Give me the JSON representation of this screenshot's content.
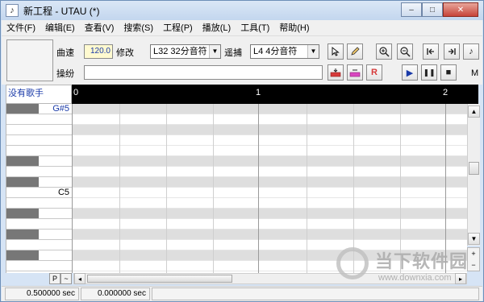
{
  "window": {
    "title": "新工程 - UTAU (*)",
    "app_icon": "music-note-icon",
    "buttons": {
      "minimize": "–",
      "maximize": "□",
      "close": "✕"
    }
  },
  "menu": [
    "文件(F)",
    "编辑(E)",
    "查看(V)",
    "搜索(S)",
    "工程(P)",
    "播放(L)",
    "工具(T)",
    "帮助(H)"
  ],
  "toolbar": {
    "tempo_label": "曲速",
    "tempo_value": "120.0",
    "tempo_after": "修改",
    "note_length": "L32 32分音符",
    "snap_label": "遥捕",
    "snap_value": "L4  4分音符",
    "lyric_label": "操纷",
    "lyric_value": "",
    "icons": {
      "pointer": "pointer-icon",
      "pencil": "pencil-icon",
      "zoom_in": "zoom-in-icon",
      "zoom_out": "zoom-out-icon",
      "go_start": "go-start-icon",
      "go_end": "go-end-icon",
      "note": "note-icon",
      "insert_note": "insert-note-icon",
      "delete_note": "delete-note-icon",
      "insert_rest": "insert-rest-icon",
      "play": "play-icon",
      "pause": "pause-icon",
      "stop": "stop-icon"
    },
    "rest_letter": "R",
    "m_label": "M",
    "play_glyph": "▶",
    "pause_glyph": "❚❚",
    "stop_glyph": "■"
  },
  "pianoroll": {
    "track_label": "没有歌手",
    "ruler_marks": [
      "0",
      "1",
      "2"
    ],
    "key_labels": {
      "top": "G#5",
      "mid": "C5"
    }
  },
  "bottom": {
    "p_button": "P",
    "tilde_button": "~",
    "left_arrow": "◂",
    "right_arrow": "▸"
  },
  "status": {
    "time1": "0.500000 sec",
    "time2": "0.000000 sec"
  },
  "watermark": {
    "text": "当下软件园",
    "url": "www.downxia.com"
  },
  "colors": {
    "ruler_bg": "#000000",
    "accent_blue": "#1a3aa8",
    "tempo_bg": "#fffad0",
    "insert_icon": "#d63a3a",
    "delete_icon": "#d946c0"
  }
}
